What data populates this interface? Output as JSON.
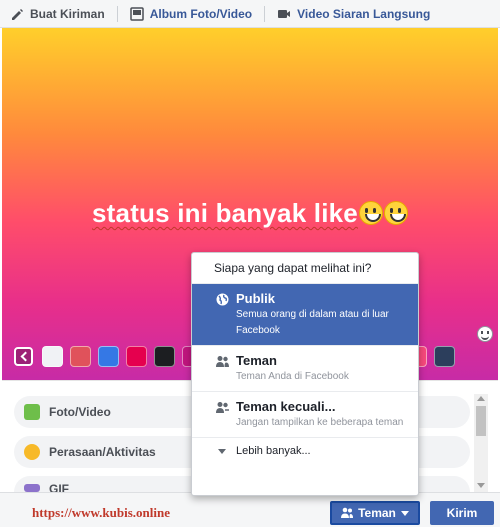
{
  "tabs": [
    {
      "label": "Buat Kiriman",
      "icon": "pencil-icon"
    },
    {
      "label": "Album Foto/Video",
      "icon": "album-icon"
    },
    {
      "label": "Video Siaran Langsung",
      "icon": "video-camera-icon"
    }
  ],
  "composer": {
    "status_text": "status ini banyak like",
    "emoji": "grinning-emoji",
    "swatch_colors": [
      "#f0f2f5",
      "#e0525b",
      "#3578e5",
      "#e5004e",
      "#1c1e21",
      "#c0157e",
      "#f7497c",
      "#2c3e5c"
    ]
  },
  "options": [
    {
      "label": "Foto/Video",
      "icon": "photo-icon",
      "color": "#6ebe4a"
    },
    {
      "label": "Perasaan/Aktivitas",
      "icon": "smiley-icon",
      "color": "#f7b928"
    },
    {
      "label": "GIF",
      "icon": "gif-icon",
      "color": "#8c72cb"
    }
  ],
  "audience_menu": {
    "header": "Siapa yang dapat melihat ini?",
    "items": [
      {
        "title": "Publik",
        "desc": "Semua orang di dalam atau di luar Facebook",
        "icon": "globe-icon",
        "selected": true
      },
      {
        "title": "Teman",
        "desc": "Teman Anda di Facebook",
        "icon": "friends-icon",
        "selected": false
      },
      {
        "title": "Teman kecuali...",
        "desc": "Jangan tampilkan ke beberapa teman",
        "icon": "friends-except-icon",
        "selected": false
      }
    ],
    "more": "Lebih banyak..."
  },
  "footer": {
    "watermark": "https://www.kubis.online",
    "audience_button": "Teman",
    "send_button": "Kirim"
  },
  "colors": {
    "brand": "#4267b2",
    "link": "#385898"
  }
}
